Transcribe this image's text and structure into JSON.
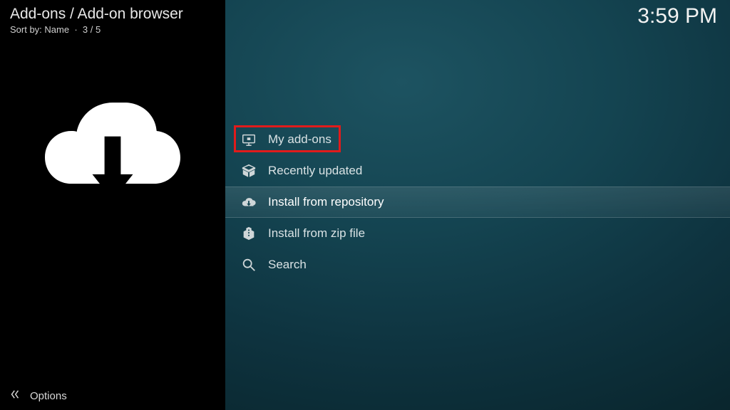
{
  "header": {
    "breadcrumb": "Add-ons / Add-on browser",
    "sort_label": "Sort by:",
    "sort_value": "Name",
    "sort_sep": "·",
    "position": "3 / 5"
  },
  "clock": "3:59 PM",
  "list": {
    "items": [
      {
        "label": "My add-ons",
        "icon": "monitor-icon",
        "highlighted": true
      },
      {
        "label": "Recently updated",
        "icon": "box-icon",
        "highlighted": false
      },
      {
        "label": "Install from repository",
        "icon": "cloud-down-icon",
        "highlighted": false,
        "selected": true
      },
      {
        "label": "Install from zip file",
        "icon": "zip-icon",
        "highlighted": false
      },
      {
        "label": "Search",
        "icon": "search-icon",
        "highlighted": false
      }
    ]
  },
  "options": {
    "label": "Options"
  },
  "colors": {
    "highlight": "#e11b1b"
  }
}
